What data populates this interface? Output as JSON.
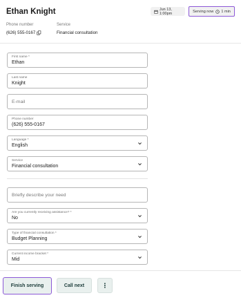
{
  "header": {
    "customer_name": "Ethan Knight",
    "date_chip": "Jun 13, 1:00pm",
    "serving_status": "Serving now",
    "serving_duration": "1 min",
    "phone_label": "Phone number",
    "phone_value": "(626) 555-0167",
    "service_label": "Service",
    "service_value": "Financial consultation"
  },
  "form": {
    "first_name": {
      "label": "First name *",
      "value": "Ethan"
    },
    "last_name": {
      "label": "Last name",
      "value": "Knight"
    },
    "email": {
      "placeholder": "E-mail"
    },
    "phone": {
      "label": "Phone number",
      "value": "(626) 555-0167"
    },
    "language": {
      "label": "Language *",
      "value": "English"
    },
    "service": {
      "label": "Service",
      "value": "Financial consultation"
    },
    "need": {
      "placeholder": "Briefly describe your need"
    },
    "assistance": {
      "label": "Are you currently receiving assistance? *",
      "value": "No"
    },
    "consultation_type": {
      "label": "Type of financial consultation *",
      "value": "Budget Planning"
    },
    "income_bracket": {
      "label": "Current income bracket *",
      "value": "Mid"
    }
  },
  "footer": {
    "finish_label": "Finish serving",
    "call_next_label": "Call next",
    "more_label": "⋮"
  },
  "colors": {
    "accent": "#8b57d6",
    "button_bg": "#e9f0ee",
    "button_text": "#1a3a38"
  },
  "icons": [
    "calendar-icon",
    "clock-icon",
    "copy-icon",
    "chevron-down-icon",
    "more-vertical-icon"
  ]
}
